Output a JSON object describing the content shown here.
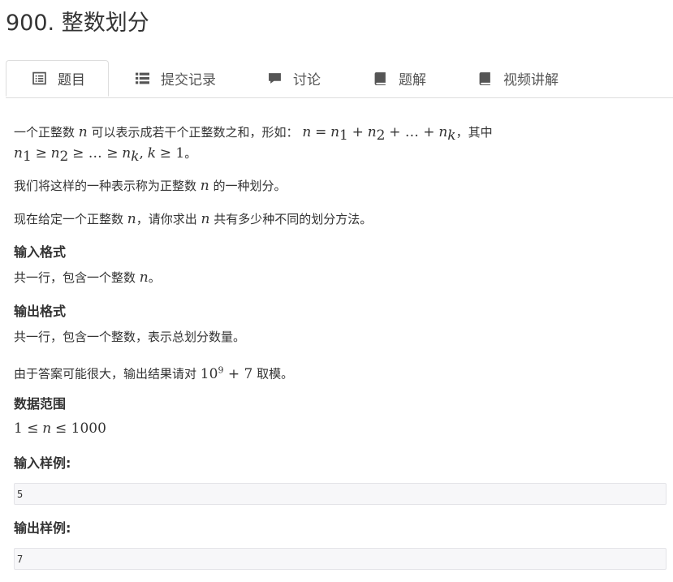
{
  "problem": {
    "title": "900. 整数划分"
  },
  "tabs": [
    {
      "label": "题目",
      "icon": "list-alt-icon",
      "active": true
    },
    {
      "label": "提交记录",
      "icon": "list-icon"
    },
    {
      "label": "讨论",
      "icon": "comment-icon"
    },
    {
      "label": "题解",
      "icon": "book-icon"
    },
    {
      "label": "视频讲解",
      "icon": "book-icon"
    }
  ],
  "statement": {
    "line1_prefix": "一个正整数",
    "line1_mid": "可以表示成若干个正整数之和，形如：",
    "line1_suffix": "，其中",
    "line2_suffix": "。",
    "line3_prefix": "我们将这样的一种表示称为正整数",
    "line3_suffix": "的一种划分。",
    "line4_prefix": "现在给定一个正整数",
    "line4_mid": "，请你求出",
    "line4_suffix": "共有多少种不同的划分方法。"
  },
  "input_format": {
    "heading": "输入格式",
    "text_prefix": "共一行，包含一个整数",
    "text_suffix": "。"
  },
  "output_format": {
    "heading": "输出格式",
    "text": "共一行，包含一个整数，表示总划分数量。",
    "mod_prefix": "由于答案可能很大，输出结果请对",
    "mod_suffix": "取模。"
  },
  "data_range": {
    "heading": "数据范围"
  },
  "sample_input": {
    "heading": "输入样例:",
    "value": "5"
  },
  "sample_output": {
    "heading": "输出样例:",
    "value": "7"
  },
  "colors": {
    "tab_border": "#dddddd",
    "sample_bg": "#f7f7f9",
    "text": "#333333"
  }
}
